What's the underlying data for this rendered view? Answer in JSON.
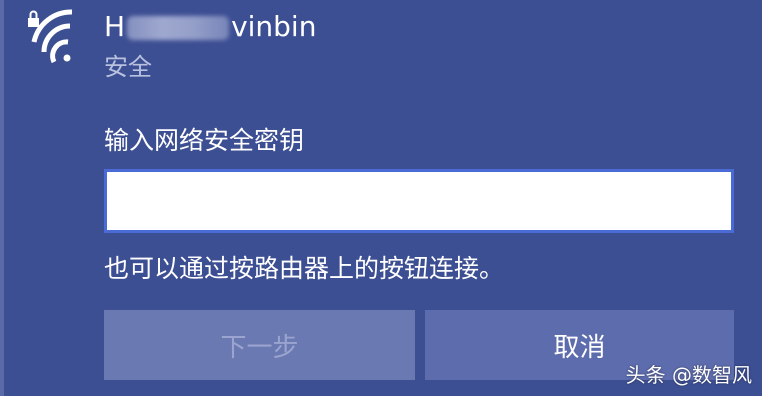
{
  "network": {
    "ssid_prefix": "H",
    "ssid_suffix": "vinbin",
    "security": "安全"
  },
  "form": {
    "key_label": "输入网络安全密钥",
    "key_value": "",
    "hint": "也可以通过按路由器上的按钮连接。"
  },
  "buttons": {
    "next_label": "下一步",
    "cancel_label": "取消"
  },
  "watermark": "头条 @数智风",
  "icons": {
    "network": "wifi-secured-icon"
  },
  "colors": {
    "background": "#3d4f93",
    "input_border": "#4a6ad6",
    "button_disabled": "#6b79b2",
    "button_cancel": "#5d6cad"
  }
}
